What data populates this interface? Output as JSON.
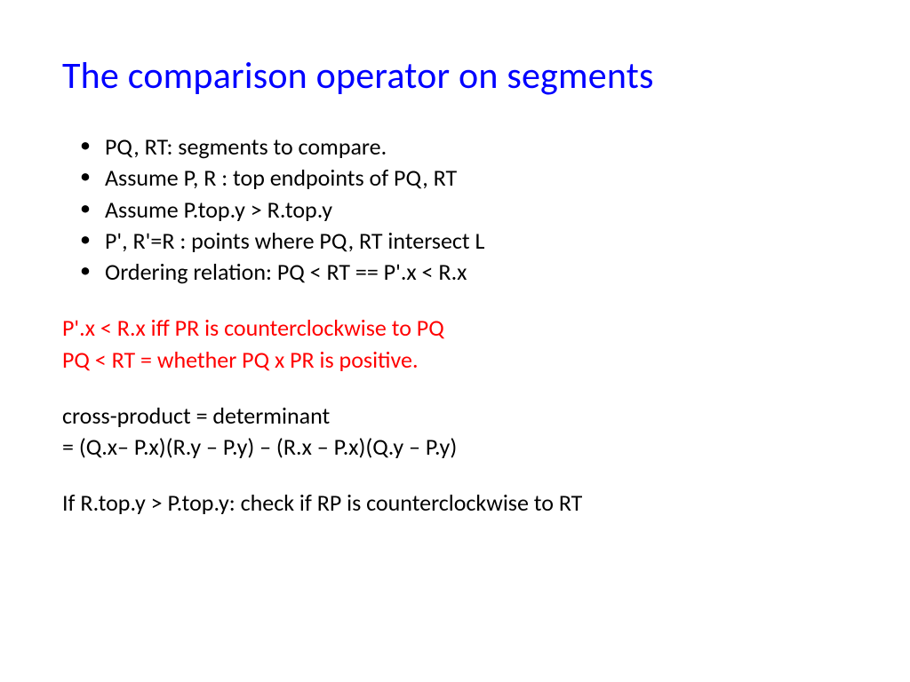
{
  "slide": {
    "title": "The comparison operator on segments",
    "bullets": [
      "PQ, RT: segments to compare.",
      "Assume P, R : top endpoints of PQ, RT",
      "Assume P.top.y > R.top.y",
      "P', R'=R : points where PQ, RT intersect L",
      "Ordering relation: PQ < RT ==  P'.x < R.x"
    ],
    "red_lines": [
      "P'.x < R.x  iff PR is counterclockwise to PQ",
      "PQ < RT  =  whether PQ x PR is positive."
    ],
    "formula_lines": [
      "cross-product = determinant",
      "= (Q.x– P.x)(R.y – P.y) – (R.x – P.x)(Q.y – P.y)"
    ],
    "final_line": "If R.top.y > P.top.y: check if RP is counterclockwise to RT"
  }
}
